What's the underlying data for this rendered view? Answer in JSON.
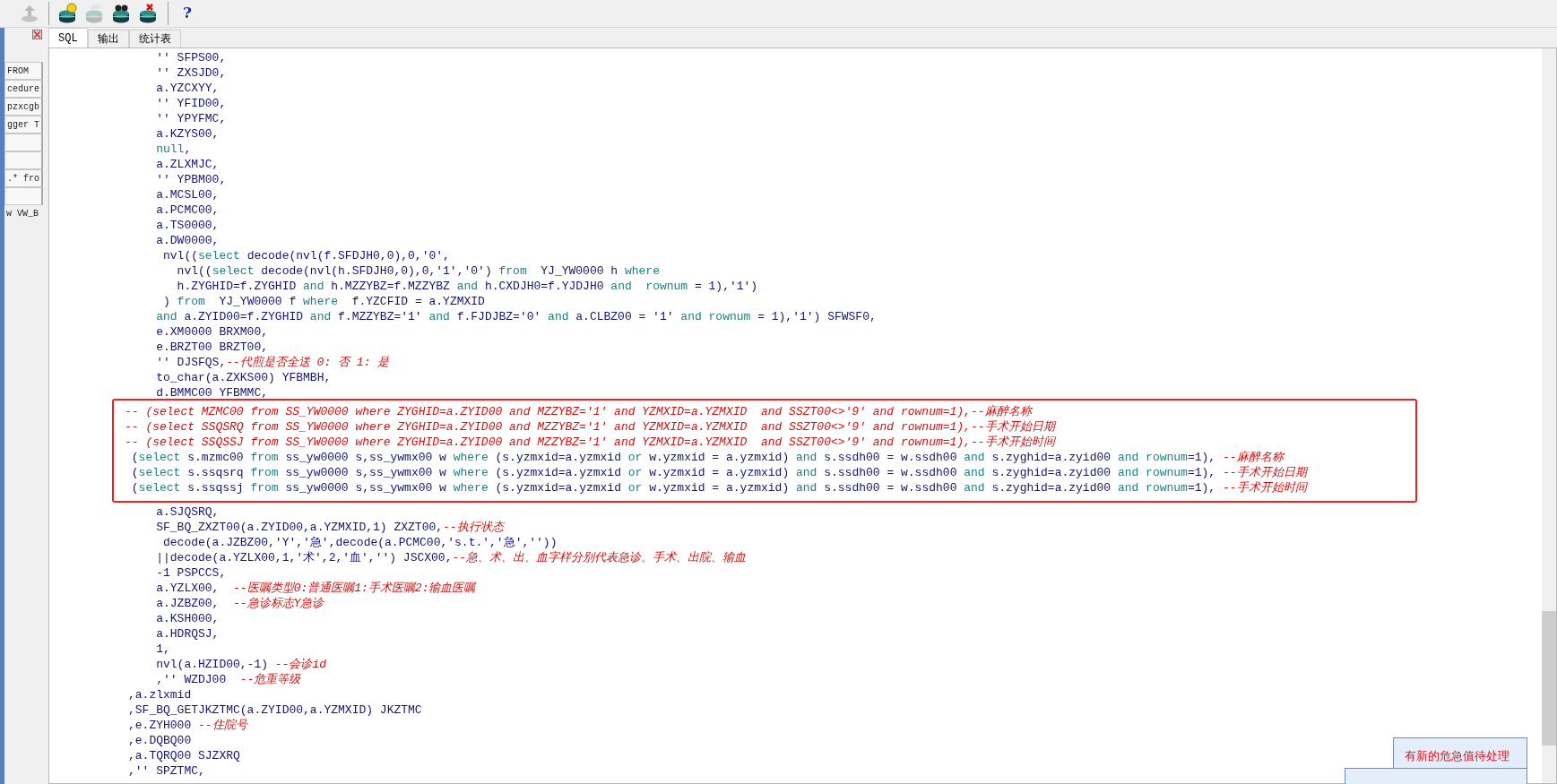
{
  "toolbar": {
    "buttons": [
      {
        "kind": "upload",
        "disabled": true
      },
      {
        "kind": "bulb",
        "disabled": false
      },
      {
        "kind": "sql",
        "disabled": true
      },
      {
        "kind": "find",
        "disabled": false
      },
      {
        "kind": "remove",
        "disabled": false
      }
    ],
    "help": "?"
  },
  "side_panel": {
    "items": [
      {
        "kind": "tab",
        "label": "FROM"
      },
      {
        "kind": "tab",
        "label": "cedure"
      },
      {
        "kind": "tab",
        "label": "pzxcgb"
      },
      {
        "kind": "tab",
        "label": "gger T"
      },
      {
        "kind": "blank"
      },
      {
        "kind": "blank"
      },
      {
        "kind": "tab",
        "label": ".* fro"
      },
      {
        "kind": "blank"
      },
      {
        "kind": "plain",
        "label": "w VW_B"
      }
    ]
  },
  "tabs": [
    {
      "label": "SQL",
      "selected": true
    },
    {
      "label": "输出",
      "selected": false
    },
    {
      "label": "统计表",
      "selected": false
    }
  ],
  "editor": {
    "lines_before": [
      {
        "tokens": [
          {
            "kind": "text",
            "text": "    '' SFPS00,"
          }
        ]
      },
      {
        "tokens": [
          {
            "kind": "text",
            "text": "    '' ZXSJD0,"
          }
        ]
      },
      {
        "tokens": [
          {
            "kind": "text",
            "text": "    a.YZCXYY,"
          }
        ]
      },
      {
        "tokens": [
          {
            "kind": "text",
            "text": "    '' YFID00,"
          }
        ]
      },
      {
        "tokens": [
          {
            "kind": "text",
            "text": "    '' YPYFMC,"
          }
        ]
      },
      {
        "tokens": [
          {
            "kind": "text",
            "text": "    a.KZYS00,"
          }
        ]
      },
      {
        "tokens": [
          {
            "kind": "keyword",
            "text": "    null"
          },
          {
            "kind": "text",
            "text": ","
          }
        ]
      },
      {
        "tokens": [
          {
            "kind": "text",
            "text": "    a.ZLXMJC,"
          }
        ]
      },
      {
        "tokens": [
          {
            "kind": "text",
            "text": "    '' YPBM00,"
          }
        ]
      },
      {
        "tokens": [
          {
            "kind": "text",
            "text": "    a.MCSL00,"
          }
        ]
      },
      {
        "tokens": [
          {
            "kind": "text",
            "text": "    a.PCMC00,"
          }
        ]
      },
      {
        "tokens": [
          {
            "kind": "text",
            "text": "    a.TS0000,"
          }
        ]
      },
      {
        "tokens": [
          {
            "kind": "text",
            "text": "    a.DW0000,"
          }
        ]
      },
      {
        "tokens": [
          {
            "kind": "text",
            "text": "     nvl(("
          },
          {
            "kind": "keyword",
            "text": "select"
          },
          {
            "kind": "text",
            "text": " decode(nvl(f.SFDJH0,0),0,'0',"
          }
        ]
      },
      {
        "tokens": [
          {
            "kind": "text",
            "text": "       nvl(("
          },
          {
            "kind": "keyword",
            "text": "select"
          },
          {
            "kind": "text",
            "text": " decode(nvl(h.SFDJH0,0),0,'1','0') "
          },
          {
            "kind": "keyword",
            "text": "from"
          },
          {
            "kind": "text",
            "text": "  YJ_YW0000 h "
          },
          {
            "kind": "keyword",
            "text": "where"
          }
        ]
      },
      {
        "tokens": [
          {
            "kind": "text",
            "text": "       h.ZYGHID=f.ZYGHID "
          },
          {
            "kind": "keyword",
            "text": "and"
          },
          {
            "kind": "text",
            "text": " h.MZZYBZ=f.MZZYBZ "
          },
          {
            "kind": "keyword",
            "text": "and"
          },
          {
            "kind": "text",
            "text": " h.CXDJH0=f.YJDJH0 "
          },
          {
            "kind": "keyword",
            "text": "and  rownum"
          },
          {
            "kind": "text",
            "text": " = 1),'1')"
          }
        ]
      },
      {
        "tokens": [
          {
            "kind": "text",
            "text": "     ) "
          },
          {
            "kind": "keyword",
            "text": "from"
          },
          {
            "kind": "text",
            "text": "  YJ_YW0000 f "
          },
          {
            "kind": "keyword",
            "text": "where"
          },
          {
            "kind": "text",
            "text": "  f.YZCFID = a.YZMXID"
          }
        ]
      },
      {
        "tokens": [
          {
            "kind": "keyword",
            "text": "    and"
          },
          {
            "kind": "text",
            "text": " a.ZYID00=f.ZYGHID "
          },
          {
            "kind": "keyword",
            "text": "and"
          },
          {
            "kind": "text",
            "text": " f.MZZYBZ='1' "
          },
          {
            "kind": "keyword",
            "text": "and"
          },
          {
            "kind": "text",
            "text": " f.FJDJBZ='0' "
          },
          {
            "kind": "keyword",
            "text": "and"
          },
          {
            "kind": "text",
            "text": " a.CLBZ00 = '1' "
          },
          {
            "kind": "keyword",
            "text": "and rownum"
          },
          {
            "kind": "text",
            "text": " = 1),'1') SFWSF0,"
          }
        ]
      },
      {
        "tokens": [
          {
            "kind": "text",
            "text": "    e.XM0000 BRXM00,"
          }
        ]
      },
      {
        "tokens": [
          {
            "kind": "text",
            "text": "    e.BRZT00 BRZT00,"
          }
        ]
      },
      {
        "tokens": [
          {
            "kind": "text",
            "text": "    '' DJSFQS,"
          },
          {
            "kind": "comment",
            "text": "--代煎是否全送 0: 否 1: 是"
          }
        ]
      },
      {
        "tokens": [
          {
            "kind": "text",
            "text": "    to_char(a.ZXKS00) YFBMBH,"
          }
        ]
      },
      {
        "tokens": [
          {
            "kind": "text",
            "text": "    d.BMMC00 YFBMMC,"
          }
        ]
      }
    ],
    "highlighted_lines": [
      {
        "tokens": [
          {
            "kind": "comment",
            "text": "-- (select MZMC00 from SS_YW0000 where ZYGHID=a.ZYID00 and MZZYBZ='1' and YZMXID=a.YZMXID  and SSZT00<>'9' and rownum=1),--麻醉名称"
          }
        ]
      },
      {
        "tokens": [
          {
            "kind": "comment",
            "text": "-- (select SSQSRQ from SS_YW0000 where ZYGHID=a.ZYID00 and MZZYBZ='1' and YZMXID=a.YZMXID  and SSZT00<>'9' and rownum=1),--手术开始日期"
          }
        ]
      },
      {
        "tokens": [
          {
            "kind": "comment",
            "text": "-- (select SSQSSJ from SS_YW0000 where ZYGHID=a.ZYID00 and MZZYBZ='1' and YZMXID=a.YZMXID  and SSZT00<>'9' and rownum=1),--手术开始时间"
          }
        ]
      },
      {
        "tokens": [
          {
            "kind": "text",
            "text": " ("
          },
          {
            "kind": "keyword",
            "text": "select"
          },
          {
            "kind": "text",
            "text": " s.mzmc00 "
          },
          {
            "kind": "keyword",
            "text": "from"
          },
          {
            "kind": "text",
            "text": " ss_yw0000 s,ss_ywmx00 w "
          },
          {
            "kind": "keyword",
            "text": "where"
          },
          {
            "kind": "text",
            "text": " (s.yzmxid=a.yzmxid "
          },
          {
            "kind": "keyword",
            "text": "or"
          },
          {
            "kind": "text",
            "text": " w.yzmxid = a.yzmxid) "
          },
          {
            "kind": "keyword",
            "text": "and"
          },
          {
            "kind": "text",
            "text": " s.ssdh00 = w.ssdh00 "
          },
          {
            "kind": "keyword",
            "text": "and"
          },
          {
            "kind": "text",
            "text": " s.zyghid=a.zyid00 "
          },
          {
            "kind": "keyword",
            "text": "and rownum"
          },
          {
            "kind": "text",
            "text": "=1), "
          },
          {
            "kind": "comment",
            "text": "--麻醉名称"
          }
        ]
      },
      {
        "tokens": [
          {
            "kind": "text",
            "text": " ("
          },
          {
            "kind": "keyword",
            "text": "select"
          },
          {
            "kind": "text",
            "text": " s.ssqsrq "
          },
          {
            "kind": "keyword",
            "text": "from"
          },
          {
            "kind": "text",
            "text": " ss_yw0000 s,ss_ywmx00 w "
          },
          {
            "kind": "keyword",
            "text": "where"
          },
          {
            "kind": "text",
            "text": " (s.yzmxid=a.yzmxid "
          },
          {
            "kind": "keyword",
            "text": "or"
          },
          {
            "kind": "text",
            "text": " w.yzmxid = a.yzmxid) "
          },
          {
            "kind": "keyword",
            "text": "and"
          },
          {
            "kind": "text",
            "text": " s.ssdh00 = w.ssdh00 "
          },
          {
            "kind": "keyword",
            "text": "and"
          },
          {
            "kind": "text",
            "text": " s.zyghid=a.zyid00 "
          },
          {
            "kind": "keyword",
            "text": "and rownum"
          },
          {
            "kind": "text",
            "text": "=1), "
          },
          {
            "kind": "comment",
            "text": "--手术开始日期"
          }
        ]
      },
      {
        "tokens": [
          {
            "kind": "text",
            "text": " ("
          },
          {
            "kind": "keyword",
            "text": "select"
          },
          {
            "kind": "text",
            "text": " s.ssqssj "
          },
          {
            "kind": "keyword",
            "text": "from"
          },
          {
            "kind": "text",
            "text": " ss_yw0000 s,ss_ywmx00 w "
          },
          {
            "kind": "keyword",
            "text": "where"
          },
          {
            "kind": "text",
            "text": " (s.yzmxid=a.yzmxid "
          },
          {
            "kind": "keyword",
            "text": "or"
          },
          {
            "kind": "text",
            "text": " w.yzmxid = a.yzmxid) "
          },
          {
            "kind": "keyword",
            "text": "and"
          },
          {
            "kind": "text",
            "text": " s.ssdh00 = w.ssdh00 "
          },
          {
            "kind": "keyword",
            "text": "and"
          },
          {
            "kind": "text",
            "text": " s.zyghid=a.zyid00 "
          },
          {
            "kind": "keyword",
            "text": "and rownum"
          },
          {
            "kind": "text",
            "text": "=1), "
          },
          {
            "kind": "comment",
            "text": "--手术开始时间"
          }
        ]
      }
    ],
    "lines_after": [
      {
        "tokens": [
          {
            "kind": "text",
            "text": "    a.SJQSRQ,"
          }
        ]
      },
      {
        "tokens": [
          {
            "kind": "text",
            "text": "    SF_BQ_ZXZT00(a.ZYID00,a.YZMXID,1) ZXZT00,"
          },
          {
            "kind": "comment",
            "text": "--执行状态"
          }
        ]
      },
      {
        "tokens": [
          {
            "kind": "text",
            "text": "     decode(a.JZBZ00,'Y','急',decode(a.PCMC00,'s.t.','急',''))"
          }
        ]
      },
      {
        "tokens": [
          {
            "kind": "text",
            "text": "    ||decode(a.YZLX00,1,'术',2,'血','') JSCX00,"
          },
          {
            "kind": "comment",
            "text": "--急、术、出、血字样分别代表急诊、手术、出院、输血"
          }
        ]
      },
      {
        "tokens": [
          {
            "kind": "text",
            "text": "    -1 PSPCCS,"
          }
        ]
      },
      {
        "tokens": [
          {
            "kind": "text",
            "text": "    a.YZLX00,  "
          },
          {
            "kind": "comment",
            "text": "--医嘱类型0:普通医嘱1:手术医嘱2:输血医嘱"
          }
        ]
      },
      {
        "tokens": [
          {
            "kind": "text",
            "text": "    a.JZBZ00,  "
          },
          {
            "kind": "comment",
            "text": "--急诊标志Y急诊"
          }
        ]
      },
      {
        "tokens": [
          {
            "kind": "text",
            "text": "    a.KSH000,"
          }
        ]
      },
      {
        "tokens": [
          {
            "kind": "text",
            "text": "    a.HDRQSJ,"
          }
        ]
      },
      {
        "tokens": [
          {
            "kind": "text",
            "text": "    1,"
          }
        ]
      },
      {
        "tokens": [
          {
            "kind": "text",
            "text": "    nvl(a.HZID00,-1) "
          },
          {
            "kind": "comment",
            "text": "--会诊id"
          }
        ]
      },
      {
        "tokens": [
          {
            "kind": "text",
            "text": "    ,'' WZDJ00  "
          },
          {
            "kind": "comment",
            "text": "--危重等级"
          }
        ]
      },
      {
        "tokens": [
          {
            "kind": "text",
            "text": ",a.zlxmid"
          }
        ]
      },
      {
        "tokens": [
          {
            "kind": "text",
            "text": ",SF_BQ_GETJKZTMC(a.ZYID00,a.YZMXID) JKZTMC"
          }
        ]
      },
      {
        "tokens": [
          {
            "kind": "text",
            "text": ",e.ZYH000 "
          },
          {
            "kind": "comment",
            "text": "--住院号"
          }
        ]
      },
      {
        "tokens": [
          {
            "kind": "text",
            "text": ",e.DQBQ00"
          }
        ]
      },
      {
        "tokens": [
          {
            "kind": "text",
            "text": ",a.TQRQ00 SJZXRQ"
          }
        ]
      },
      {
        "tokens": [
          {
            "kind": "text",
            "text": ",'' SPZTMC,"
          }
        ]
      }
    ]
  },
  "notification": {
    "message": "有新的危急值待处理"
  }
}
